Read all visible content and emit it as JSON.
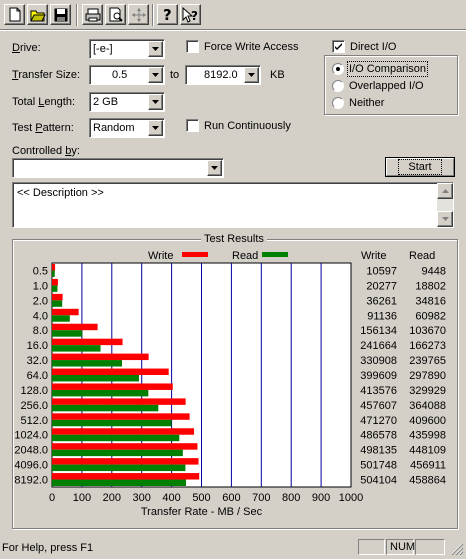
{
  "toolbar": {
    "buttons": [
      "new-file-icon",
      "open-folder-icon",
      "save-disk-icon",
      "print-icon",
      "print-preview-icon",
      "move-cross-icon",
      "help-question-icon",
      "context-help-icon"
    ]
  },
  "drive": {
    "label": "Drive:",
    "value": "[-e-]"
  },
  "transfer_size": {
    "label": "Transfer Size:",
    "from": "0.5",
    "to_label": "to",
    "to": "8192.0",
    "unit": "KB"
  },
  "total_length": {
    "label": "Total Length:",
    "value": "2 GB"
  },
  "test_pattern": {
    "label": "Test Pattern:",
    "value": "Random"
  },
  "force_write": {
    "label": "Force Write Access",
    "checked": false
  },
  "run_continuously": {
    "label": "Run Continuously",
    "checked": false
  },
  "direct_io": {
    "label": "Direct I/O",
    "checked": true
  },
  "io_mode": {
    "options": [
      "I/O Comparison",
      "Overlapped I/O",
      "Neither"
    ],
    "selected": "I/O Comparison"
  },
  "controlled_by": {
    "label": "Controlled by:",
    "value": ""
  },
  "start_button": "Start",
  "description": "<< Description >>",
  "results": {
    "title": "Test Results",
    "write_legend": "Write",
    "read_legend": "Read",
    "write_header": "Write",
    "read_header": "Read",
    "write_color": "#ff0000",
    "read_color": "#008000"
  },
  "chart_data": {
    "type": "bar",
    "orientation": "horizontal",
    "categories": [
      "0.5",
      "1.0",
      "2.0",
      "4.0",
      "8.0",
      "16.0",
      "32.0",
      "64.0",
      "128.0",
      "256.0",
      "512.0",
      "1024.0",
      "2048.0",
      "4096.0",
      "8192.0"
    ],
    "series": [
      {
        "name": "Write",
        "values": [
          10597,
          20277,
          36261,
          91136,
          156134,
          241664,
          330908,
          399609,
          413576,
          457607,
          471270,
          486578,
          498135,
          501748,
          504104
        ]
      },
      {
        "name": "Read",
        "values": [
          9448,
          18802,
          34816,
          60982,
          103670,
          166273,
          239765,
          297890,
          329929,
          364088,
          409600,
          435998,
          448109,
          456911,
          458864
        ]
      }
    ],
    "xlabel": "Transfer Rate - MB / Sec",
    "xlim": [
      0,
      1000
    ],
    "xticks": [
      "0",
      "100",
      "200",
      "300",
      "400",
      "500",
      "600",
      "700",
      "800",
      "900",
      "1000"
    ],
    "grid": true,
    "legend": "top"
  },
  "status": {
    "help": "For Help, press F1",
    "num": "NUM"
  }
}
